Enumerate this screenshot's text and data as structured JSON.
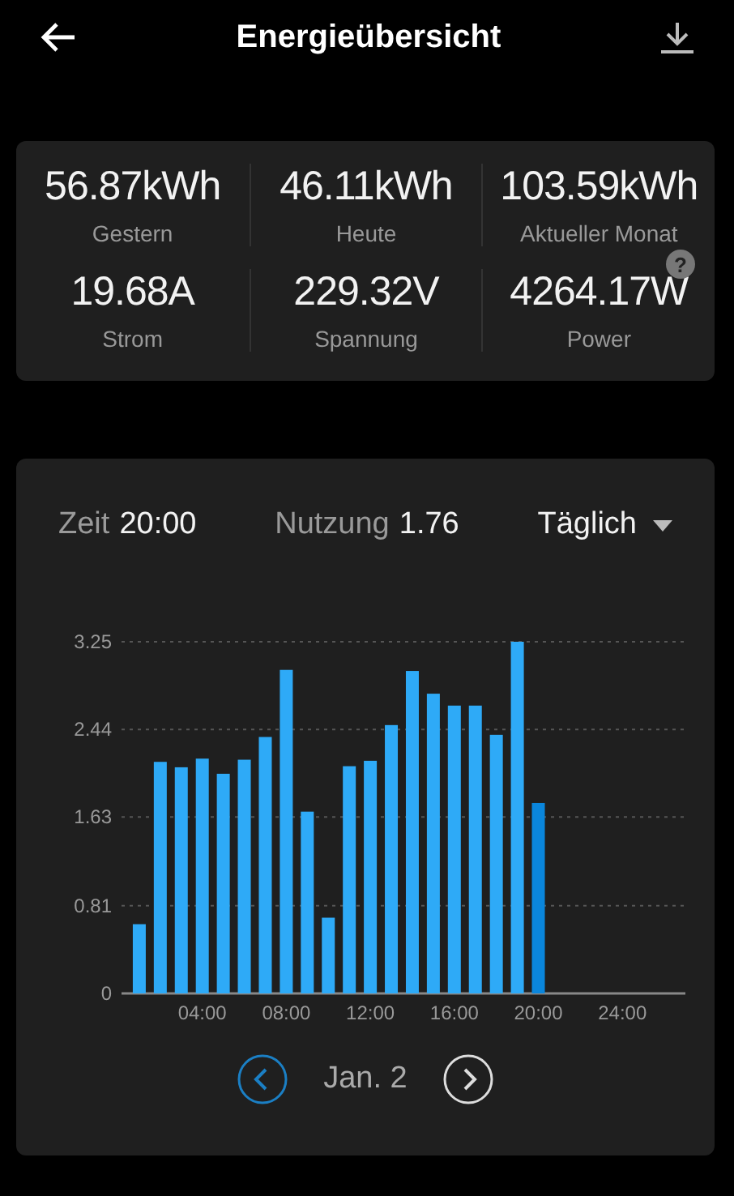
{
  "header": {
    "title": "Energieübersicht"
  },
  "stats": [
    {
      "value": "56.87kWh",
      "label": "Gestern"
    },
    {
      "value": "46.11kWh",
      "label": "Heute"
    },
    {
      "value": "103.59kWh",
      "label": "Aktueller Monat"
    },
    {
      "value": "19.68A",
      "label": "Strom"
    },
    {
      "value": "229.32V",
      "label": "Spannung"
    },
    {
      "value": "4264.17W",
      "label": "Power",
      "help": "?"
    }
  ],
  "usage": {
    "time_label": "Zeit",
    "time": "20:00",
    "usage_label": "Nutzung",
    "usage": "1.76",
    "period": "Täglich",
    "chart_data": {
      "type": "bar",
      "stacked": true,
      "grid": true,
      "x": [
        1,
        2,
        3,
        4,
        5,
        6,
        7,
        8,
        9,
        10,
        11,
        12,
        13,
        14,
        15,
        16,
        17,
        18,
        19,
        20
      ],
      "xlim": [
        0,
        27
      ],
      "ylim": [
        0,
        3.25
      ],
      "xticks": [
        {
          "value": 4,
          "label": "04:00"
        },
        {
          "value": 8,
          "label": "08:00"
        },
        {
          "value": 12,
          "label": "12:00"
        },
        {
          "value": 16,
          "label": "16:00"
        },
        {
          "value": 20,
          "label": "20:00"
        },
        {
          "value": 24,
          "label": "24:00"
        }
      ],
      "yticks": [
        0,
        0.81,
        1.63,
        2.44,
        3.25
      ],
      "series": [
        {
          "color": "#2eaaf7",
          "values": [
            0.64,
            2.14,
            2.09,
            2.17,
            2.03,
            2.16,
            2.37,
            2.99,
            1.68,
            0.7,
            2.1,
            2.15,
            2.48,
            2.98,
            2.77,
            2.66,
            2.66,
            2.39,
            3.25,
            null
          ]
        },
        {
          "color": "#0a86dc",
          "values": [
            null,
            null,
            null,
            null,
            null,
            null,
            null,
            null,
            null,
            null,
            null,
            null,
            null,
            null,
            null,
            null,
            null,
            null,
            null,
            1.76
          ]
        }
      ]
    },
    "date": "Jan. 2"
  }
}
